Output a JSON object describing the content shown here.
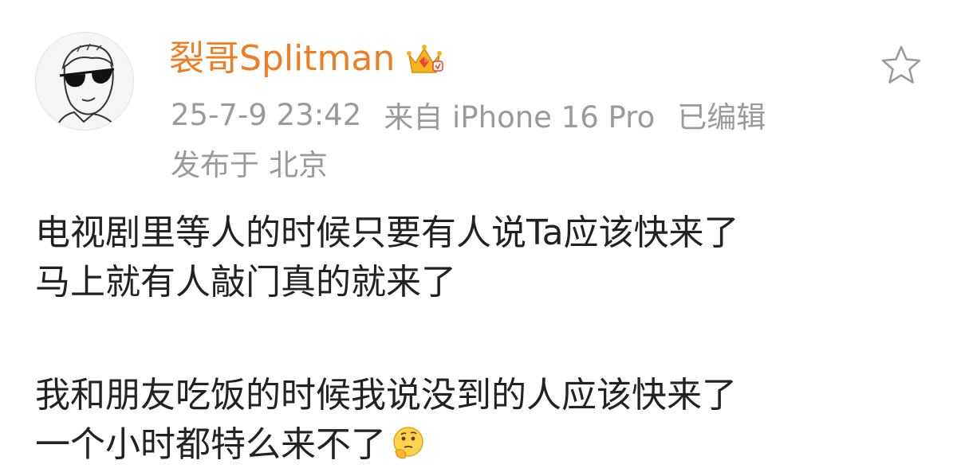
{
  "post": {
    "author": {
      "name": "裂哥Splitman",
      "badge_icon": "crown-vip-icon",
      "name_color": "#ef7d22"
    },
    "meta": {
      "time": "25-7-9 23:42",
      "source": "来自 iPhone 16 Pro",
      "edited": "已编辑"
    },
    "location": {
      "prefix": "发布于",
      "place": "北京"
    },
    "favorite_icon": "star-outline-icon",
    "body": {
      "paragraph1": [
        "电视剧里等人的时候只要有人说Ta应该快来了",
        "马上就有人敲门真的就来了"
      ],
      "paragraph2": [
        "我和朋友吃饭的时候我说没到的人应该快来了",
        "一个小时都特么来不了"
      ],
      "trailing_emoji": "thinking-face-emoji"
    },
    "colors": {
      "meta_text": "#9a9a9a",
      "body_text": "#222222"
    }
  }
}
